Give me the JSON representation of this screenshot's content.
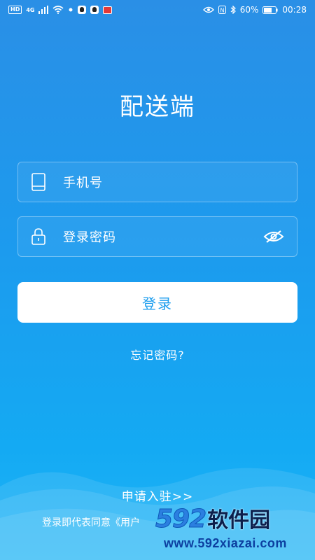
{
  "status_bar": {
    "hd": "HD",
    "network": "4G",
    "battery": "60%",
    "time": "00:28"
  },
  "title": "配送端",
  "phone_field": {
    "placeholder": "手机号",
    "icon": "phone-icon"
  },
  "password_field": {
    "placeholder": "登录密码",
    "icon": "lock-icon",
    "toggle_icon": "eye-off-icon"
  },
  "login_button": "登录",
  "forgot_password": "忘记密码?",
  "apply_link": "申请入驻>>",
  "agreement_text": "登录即代表同意《用户",
  "watermark": {
    "number": "592",
    "name": "软件园",
    "url": "www.592xiazai.com"
  },
  "colors": {
    "primary": "#1e9eee",
    "background_top": "#2a8fe6",
    "background_bottom": "#1fb4f6"
  }
}
